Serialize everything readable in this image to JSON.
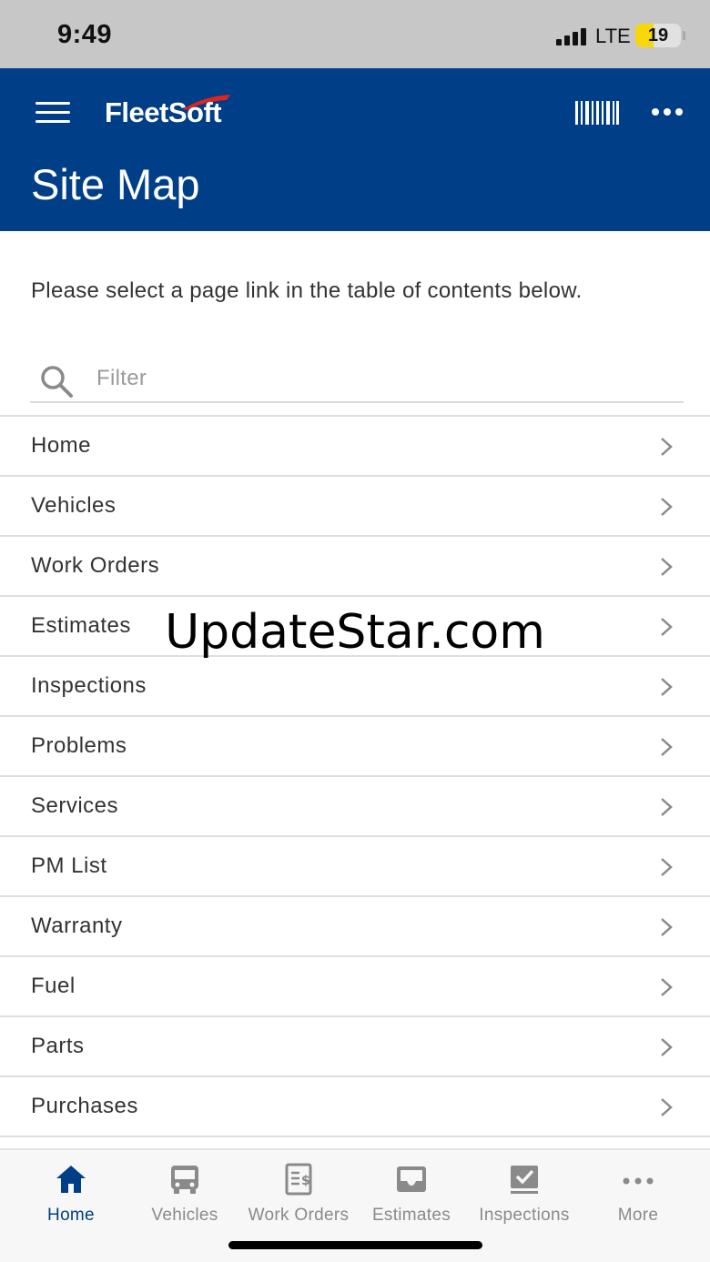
{
  "status_bar": {
    "time": "9:49",
    "network": "LTE",
    "battery": "19"
  },
  "header": {
    "logo": "FleetSoft",
    "title": "Site Map"
  },
  "intro_text": "Please select a page link in the table of contents below.",
  "filter": {
    "placeholder": "Filter",
    "value": ""
  },
  "list_items": [
    {
      "label": "Home"
    },
    {
      "label": "Vehicles"
    },
    {
      "label": "Work Orders"
    },
    {
      "label": "Estimates"
    },
    {
      "label": "Inspections"
    },
    {
      "label": "Problems"
    },
    {
      "label": "Services"
    },
    {
      "label": "PM List"
    },
    {
      "label": "Warranty"
    },
    {
      "label": "Fuel"
    },
    {
      "label": "Parts"
    },
    {
      "label": "Purchases"
    }
  ],
  "watermark": "UpdateStar.com",
  "tab_bar": {
    "active": "Home",
    "tabs": [
      {
        "label": "Home",
        "icon": "home-icon"
      },
      {
        "label": "Vehicles",
        "icon": "bus-icon"
      },
      {
        "label": "Work Orders",
        "icon": "work-order-icon"
      },
      {
        "label": "Estimates",
        "icon": "inbox-icon"
      },
      {
        "label": "Inspections",
        "icon": "checklist-icon"
      },
      {
        "label": "More",
        "icon": "more-icon"
      }
    ]
  },
  "colors": {
    "brand": "#003f87",
    "status_bar": "#c7c7c7",
    "battery": "#f8d70a",
    "logo_swoosh": "#e2231a",
    "tab_inactive": "#8a8a8a"
  }
}
